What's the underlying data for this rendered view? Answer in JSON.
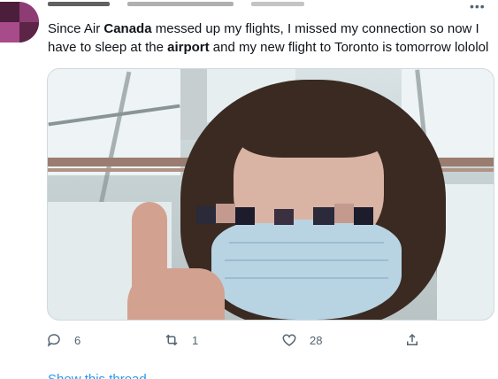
{
  "tweet": {
    "text_parts": [
      {
        "text": "Since Air ",
        "bold": false
      },
      {
        "text": "Canada",
        "bold": true
      },
      {
        "text": " messed up my flights, I missed my connection so now I have to sleep at the ",
        "bold": false
      },
      {
        "text": "airport",
        "bold": true
      },
      {
        "text": " and my new flight to Toronto is tomorrow lololol",
        "bold": false
      }
    ],
    "more_icon": "more-horizontal-icon"
  },
  "actions": {
    "reply": {
      "icon": "reply-icon",
      "count": "6"
    },
    "retweet": {
      "icon": "retweet-icon",
      "count": "1"
    },
    "like": {
      "icon": "heart-icon",
      "count": "28"
    },
    "share": {
      "icon": "share-icon"
    }
  },
  "thread_link": {
    "label": "Show this thread"
  },
  "colors": {
    "text": "#0f1419",
    "secondary": "#536471",
    "link": "#1d9bf0",
    "border": "#cfd9de"
  }
}
